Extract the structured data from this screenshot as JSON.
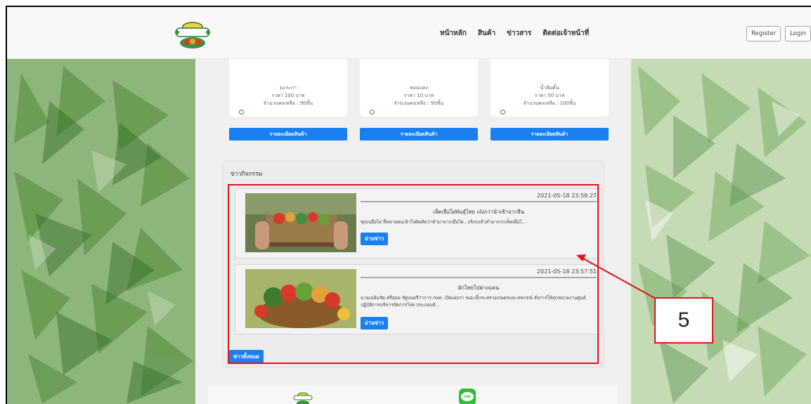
{
  "header": {
    "nav": [
      "หน้าหลัก",
      "สินค้า",
      "ข่าวสาร",
      "ติดต่อเจ้าหน้าที่"
    ],
    "register_label": "Register",
    "login_label": "Login"
  },
  "products": [
    {
      "name": "มะระกา",
      "price": "ราคา 100 บาท",
      "stock": "จำนวนคงเหลือ : 90ชิ้น",
      "button": "รายละเอียดสินค้า"
    },
    {
      "name": "หอมแดง",
      "price": "ราคา 10 บาท",
      "stock": "จำนวนคงเหลือ : 90ชิ้น",
      "button": "รายละเอียดสินค้า"
    },
    {
      "name": "น้ำส้มคั้น",
      "price": "ราคา 50 บาท",
      "stock": "จำนวนคงเหลือ : 100ชิ้น",
      "button": "รายละเอียดสินค้า"
    }
  ],
  "news": {
    "section_title": "ข่าวกิจกรรม",
    "items": [
      {
        "date": "2021-05-18 23:58:27",
        "headline": "เห็ดเยื่อไผ่พันธุ์ไทย เจ๋งกว่านำเข้าจากจีน",
        "excerpt": "ซุปเนยื่อไผ่ ที่หลายคนเข้าใจผิดคิดว่าทำมาจากเยื่อไผ่...จริงๆแล้วทำมาจากเห็ดเยื่อไ...",
        "read_label": "อ่านข่าว"
      },
      {
        "date": "2021-05-18 23:57:51",
        "headline": "ผักไทยไปต่างแดน",
        "excerpt": "นายเฉลิมชัย ศรีอ่อน รัฐมนตรีว่าการ กษท. เปิดเผยว่า ขณะนี้กระทรวงเกษตรและสหกรณ์ สั่งการให้ทุกหน่วยงานศูนย์ปฏิบัติการบริหารจัดการโรค ประกอบด้...",
        "read_label": "อ่านข่าว"
      }
    ],
    "all_label": "ข่าวทั้งหมด"
  },
  "annotation": {
    "callout_number": "5",
    "color": "#e0141e"
  },
  "colors": {
    "primary_button": "#1a7ff0",
    "leaf_green": "#7fa96a"
  }
}
